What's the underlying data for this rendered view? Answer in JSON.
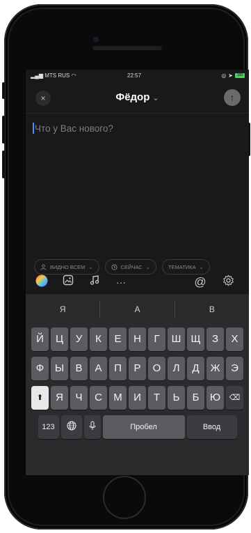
{
  "status": {
    "carrier": "MTS RUS",
    "time": "22:57",
    "battery": "100"
  },
  "header": {
    "close_icon": "×",
    "title": "Фёдор",
    "title_chevron": "⌄",
    "send_icon": "↑"
  },
  "composer": {
    "placeholder": "Что у Вас нового?"
  },
  "chips": [
    {
      "icon": "user-icon",
      "label": "ВИДНО ВСЕМ"
    },
    {
      "icon": "clock-icon",
      "label": "СЕЙЧАС"
    },
    {
      "icon": "tag-icon",
      "label": "ТЕМАТИКА"
    }
  ],
  "toolbar": {
    "more_label": "···",
    "mention_label": "@"
  },
  "keyboard": {
    "suggestions": [
      "Я",
      "А",
      "В"
    ],
    "row1": [
      "Й",
      "Ц",
      "У",
      "К",
      "Е",
      "Н",
      "Г",
      "Ш",
      "Щ",
      "З",
      "Х"
    ],
    "row2": [
      "Ф",
      "Ы",
      "В",
      "А",
      "П",
      "Р",
      "О",
      "Л",
      "Д",
      "Ж",
      "Э"
    ],
    "row3": [
      "Я",
      "Ч",
      "С",
      "М",
      "И",
      "Т",
      "Ь",
      "Б",
      "Ю"
    ],
    "numbers_label": "123",
    "space_label": "Пробел",
    "return_label": "Ввод"
  }
}
